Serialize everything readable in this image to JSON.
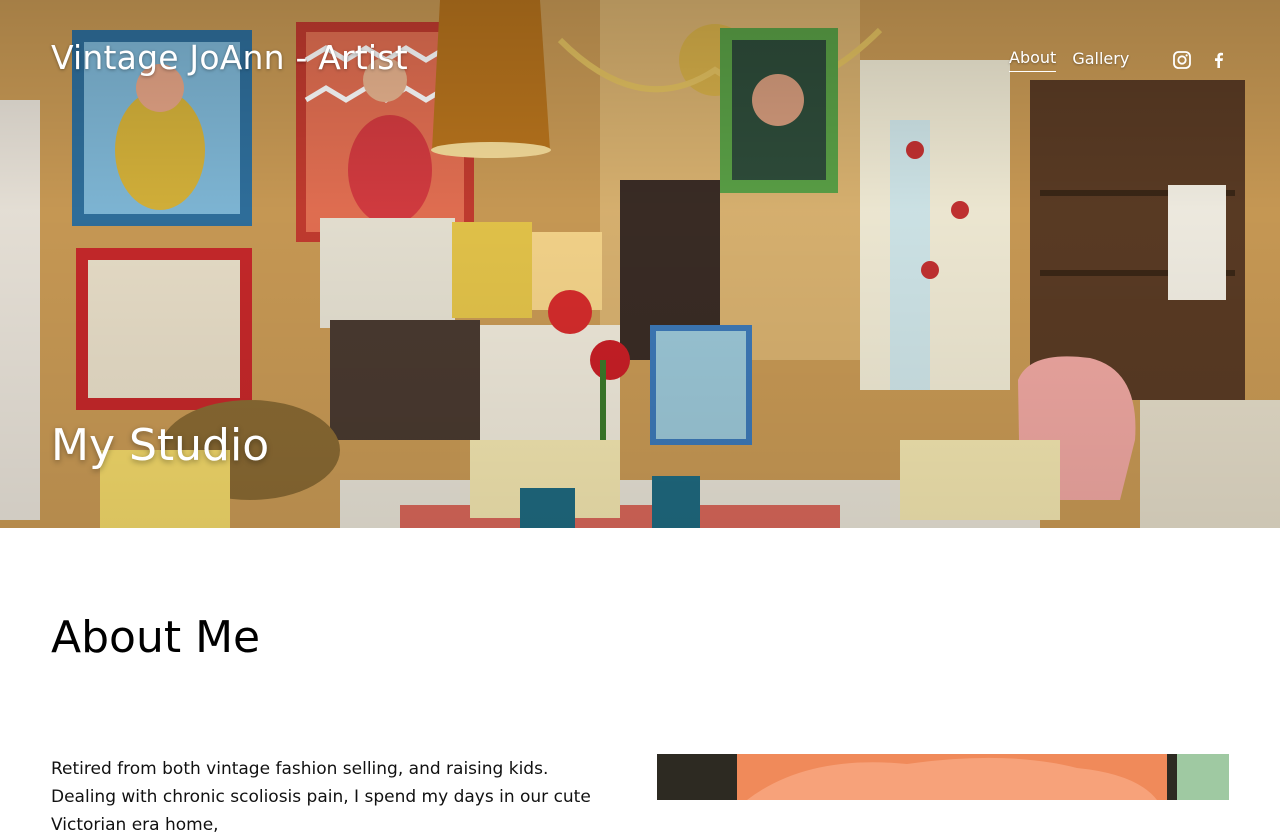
{
  "header": {
    "site_title": "Vintage JoAnn - Artist",
    "nav": [
      {
        "label": "About",
        "active": true
      },
      {
        "label": "Gallery",
        "active": false
      }
    ],
    "social": [
      {
        "icon": "instagram-icon"
      },
      {
        "icon": "facebook-icon"
      }
    ]
  },
  "hero": {
    "heading": "My Studio",
    "image": "artist-studio-photo"
  },
  "about": {
    "title": "About Me",
    "text": "Retired from both vintage fashion selling, and raising kids. Dealing with chronic scoliosis pain, I spend my days in our cute Victorian era home,",
    "image": "artist-portrait-photo"
  },
  "colors": {
    "text_dark": "#000000",
    "text_light": "#ffffff",
    "background": "#ffffff"
  }
}
